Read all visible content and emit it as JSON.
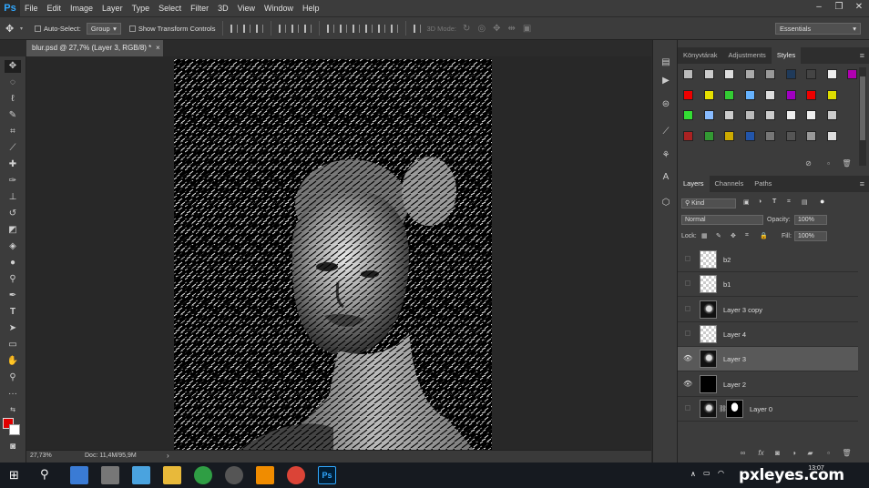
{
  "app": {
    "logo": "Ps"
  },
  "menu": [
    "File",
    "Edit",
    "Image",
    "Layer",
    "Type",
    "Select",
    "Filter",
    "3D",
    "View",
    "Window",
    "Help"
  ],
  "window_controls": [
    "–",
    "❐",
    "✕"
  ],
  "options": {
    "auto_select_label": "Auto-Select:",
    "auto_select_value": "Group",
    "show_transform_label": "Show Transform Controls",
    "mode_3d_label": "3D Mode:",
    "workspace": "Essentials"
  },
  "document": {
    "tab_title": "blur.psd @ 27,7% (Layer 3, RGB/8) *",
    "tab_close": "×",
    "zoom": "27,73%",
    "doc_info": "Doc: 11,4M/95,9M"
  },
  "colors": {
    "foreground": "#e00000",
    "background": "#ffffff",
    "accent": "#31a8ff"
  },
  "panels": {
    "top_tabs": [
      {
        "label": "Könyvtárak",
        "active": false
      },
      {
        "label": "Adjustments",
        "active": false
      },
      {
        "label": "Styles",
        "active": true
      }
    ],
    "layer_tabs": [
      {
        "label": "Layers",
        "active": true
      },
      {
        "label": "Channels",
        "active": false
      },
      {
        "label": "Paths",
        "active": false
      }
    ],
    "filter_kind": "Kind",
    "blend_mode": "Normal",
    "opacity_label": "Opacity:",
    "opacity_value": "100%",
    "lock_label": "Lock:",
    "fill_label": "Fill:",
    "fill_value": "100%"
  },
  "layers": [
    {
      "name": "b2",
      "visible": false,
      "thumb": "transparent",
      "selected": false
    },
    {
      "name": "b1",
      "visible": false,
      "thumb": "transparent",
      "selected": false
    },
    {
      "name": "Layer 3 copy",
      "visible": false,
      "thumb": "face",
      "selected": false
    },
    {
      "name": "Layer 4",
      "visible": false,
      "thumb": "transparent",
      "selected": false
    },
    {
      "name": "Layer 3",
      "visible": true,
      "thumb": "face",
      "selected": true
    },
    {
      "name": "Layer 2",
      "visible": true,
      "thumb": "black",
      "selected": false
    },
    {
      "name": "Layer 0",
      "visible": false,
      "thumb": "face",
      "selected": false,
      "mask": true
    }
  ],
  "taskbar": {
    "time": "13:07",
    "watermark": "pxleyes.com"
  }
}
